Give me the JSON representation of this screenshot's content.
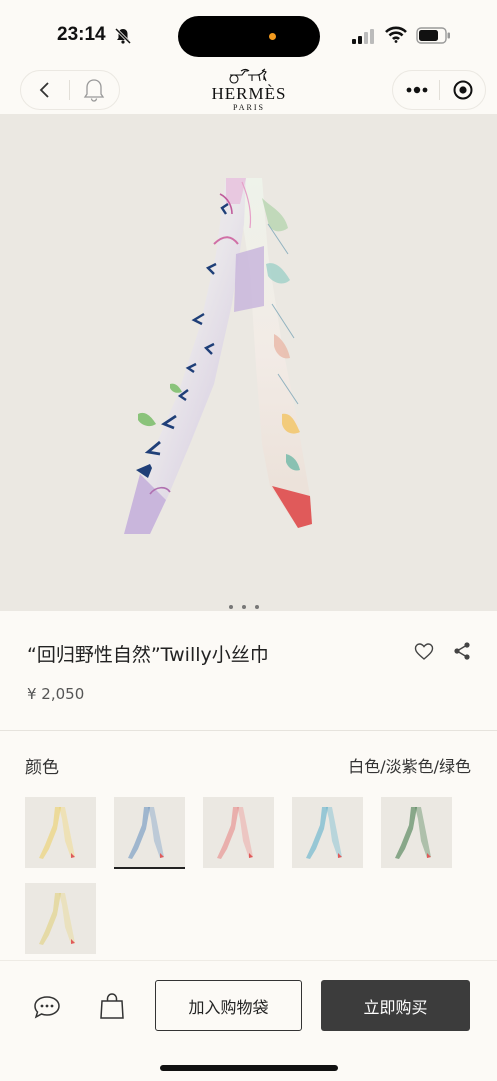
{
  "status_bar": {
    "time": "23:14",
    "icons": [
      "bell-off-icon",
      "signal-icon",
      "wifi-icon",
      "battery-icon"
    ]
  },
  "nav": {
    "brand": "HERMÈS",
    "brand_sub": "PARIS",
    "icons": [
      "back-icon",
      "bell-icon",
      "more-icon",
      "target-icon"
    ]
  },
  "product": {
    "title": "“回归野性自然”Twilly小丝巾",
    "price": "¥ 2,050",
    "image_pages": 3,
    "current_image": 1
  },
  "color": {
    "label": "颜色",
    "value": "白色/淡紫色/绿色",
    "swatches": [
      {
        "name": "swatch-1",
        "accent": "#e5c95a",
        "selected": false
      },
      {
        "name": "swatch-2",
        "accent": "#5a86b8",
        "selected": true
      },
      {
        "name": "swatch-3",
        "accent": "#e07a7a",
        "selected": false
      },
      {
        "name": "swatch-4",
        "accent": "#4aa6c4",
        "selected": false
      },
      {
        "name": "swatch-5",
        "accent": "#2f6b3a",
        "selected": false
      },
      {
        "name": "swatch-6",
        "accent": "#d9c870",
        "selected": false
      }
    ]
  },
  "actions": {
    "add_to_cart": "加入购物袋",
    "buy_now": "立即购买"
  }
}
